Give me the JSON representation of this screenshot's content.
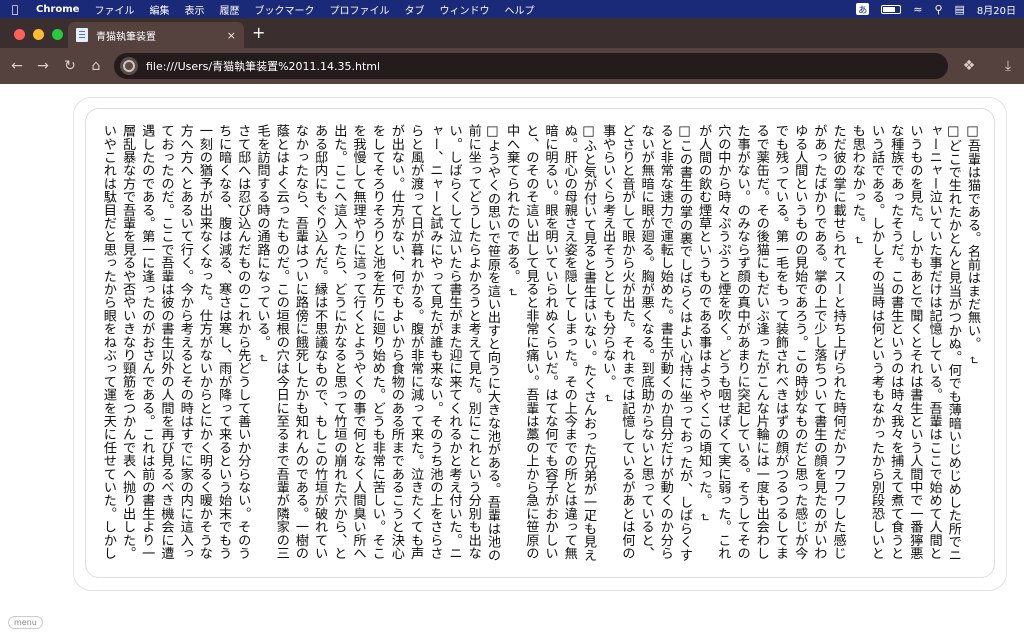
{
  "menubar": {
    "app": "Chrome",
    "items": [
      "ファイル",
      "編集",
      "表示",
      "履歴",
      "ブックマーク",
      "プロファイル",
      "タブ",
      "ウィンドウ",
      "ヘルプ"
    ],
    "ime": "あ",
    "date": "8月20日"
  },
  "tab": {
    "title": "青猫執筆装置",
    "close": "×"
  },
  "toolbar": {
    "new_tab": "+",
    "url": "file:///Users/青猫執筆装置%2011.14.35.html"
  },
  "document": {
    "paragraphs": [
      "□吾輩は猫である。名前はまだ無い。",
      "",
      "□どこで生れたかとんと見当がつかぬ。何でも薄暗いじめじめした所でニャーニャー泣いていた事だけは記憶している。吾輩はここで始めて人間というものを見た。しかもあとで聞くとそれは書生という人間中で一番獰悪な種族であったそうだ。この書生というのは時々我々を捕えて煮て食うという話である。しかしその当時は何という考もなかったから別段恐しいとも思わなかった。",
      "",
      "ただ彼の掌に載せられてスーと持ち上げられた時何だかフワフワした感じがあったばかりである。掌の上で少し落ちついて書生の顔を見たのがいわゆる人間というものの見始であろう。この時妙なものだと思った感じが今でも残っている。第一毛をもって装飾されべきはずの顔がつるつるしてまるで薬缶だ。その後猫にもだいぶ逢ったがこんな片輪には一度も出会わした事がない。のみならず顔の真中があまりに突起している。そうしてその穴の中から時々ぷうぷうと煙を吹く。どうも咽せぽくて実に弱った。これが人間の飲む煙草というものである事はようやくこの頃知った。",
      "",
      "□この書生の掌の裏でしばらくはよい心持に坐っておったが、しばらくすると非常な速力で運転し始めた。書生が動くのか自分だけが動くのか分らないが無暗に眼が廻る。胸が悪くなる。到底助からないと思っていると、どさりと音がして眼から火が出た。それまでは記憶しているがあとは何の事やらいくら考え出そうとしても分らない。",
      "",
      "□ふと気が付いて見ると書生はいない。たくさんおった兄弟が一疋も見えぬ。肝心の母親さえ姿を隠してしまった。その上今までの所とは違って無暗に明るい。眼を明いていられぬくらいだ。はてな何でも容子がおかしいと、のそのそ這い出して見ると非常に痛い。吾輩は藁の上から急に笹原の中へ棄てられたのである。",
      "",
      "□ようやくの思いで笹原を這い出すと向うに大きな池がある。吾輩は池の前に坐ってどうしたらよかろうと考えて見た。別にこれという分別も出ない。しばらくして泣いたら書生がまた迎に来てくれるかと考え付いた。ニャー、ニャーと試みにやって見たが誰も来ない。そのうち池の上をさらさらと風が渡って日が暮れかかる。腹が非常に減って来た。泣きたくても声が出ない。仕方がない、何でもよいから食物のある所まであるこうと決心をしてそろりそろりと池を左りに廻り始めた。どうも非常に苦しい。そこを我慢して無理やりに這って行くとようやくの事で何となく人間臭い所へ出た。ここへ這入ったら、どうにかなると思って竹垣の崩れた穴から、とある邸内にもぐり込んだ。縁は不思議なもので、もしこの竹垣が破れていなかったなら、吾輩はついに路傍に餓死したかも知れんのである。一樹の蔭とはよく云ったものだ。この垣根の穴は今日に至るまで吾輩が隣家の三毛を訪問する時の通路になっている。",
      "",
      "さて邸へは忍び込んだもののこれから先どうして善いか分らない。そのうちに暗くなる、腹は減る、寒さは寒し、雨が降って来るという始末でもう一刻の猶予が出来なくなった。仕方がないからとにかく明るく暖かそうな方へ方へとあるいて行く。今から考えるとその時はすでに家の内に這入っておったのだ。ここで吾輩は彼の書生以外の人間を再び見るべき機会に遭遇したのである。第一に逢ったのがおさんである。これは前の書生より一層乱暴な方で吾輩を見るや否やいきなり頸筋をつかんで表へ抛り出した。いやこれは駄目だと思ったから眼をねぶって運を天に任せていた。しかしひもじいのと寒いのにはどうしても我慢が出来ん。吾輩は再びおさんの隙を見て台所へ這い上った。すると間もなくまた投げ出された。吾輩は投げ出されては這い上り、這い上っては投げ出され、何でも同じ事を四五遍繰り返したのを記憶している。"
    ]
  },
  "footer": {
    "menu_label": "menu"
  }
}
